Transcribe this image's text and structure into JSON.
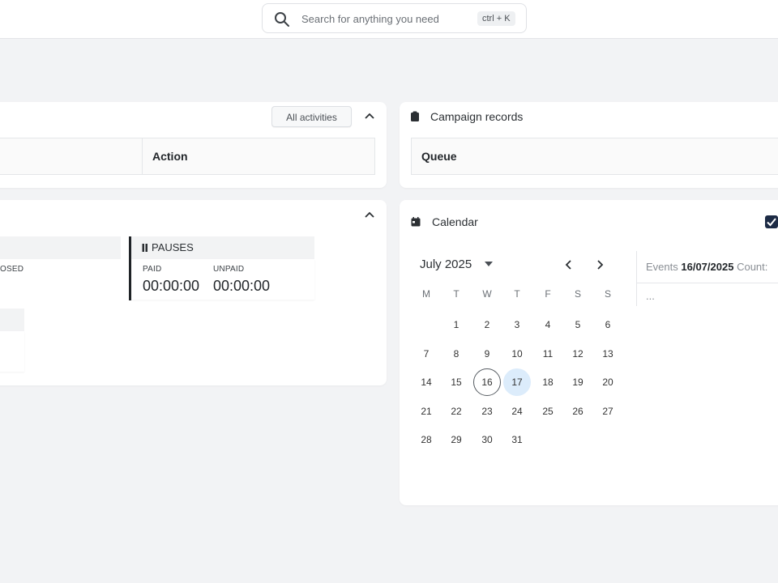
{
  "search": {
    "placeholder": "Search for anything you need",
    "shortcut": "ctrl + K"
  },
  "activities": {
    "filter_button": "All activities",
    "columns": [
      "Action"
    ]
  },
  "campaign": {
    "title": "Campaign records",
    "columns": [
      "Queue"
    ]
  },
  "status": {
    "closed_label_partial": "OSED",
    "pauses": {
      "title": "PAUSES",
      "paid_label": "PAID",
      "paid_value": "00:00:00",
      "unpaid_label": "UNPAID",
      "unpaid_value": "00:00:00"
    }
  },
  "calendar": {
    "title": "Calendar",
    "month": "July 2025",
    "weekdays": [
      "M",
      "T",
      "W",
      "T",
      "F",
      "S",
      "S"
    ],
    "first_weekday_index": 1,
    "days_in_month": 31,
    "today": 16,
    "selected": 17,
    "events_label": "Events",
    "events_date": "16/07/2025",
    "count_label": "Count:",
    "events_placeholder": "..."
  },
  "colors": {
    "selected_day_bg": "#dcecfb",
    "checkbox": "#1d2b45"
  }
}
